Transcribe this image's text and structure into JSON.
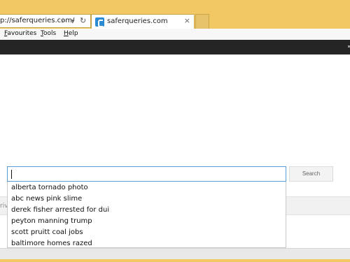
{
  "browser": {
    "address_url": "p://saferqueries.com/",
    "tab_title": "saferqueries.com",
    "tab_close": "×",
    "search_glyph": "⌕",
    "dropdown_glyph": "▾",
    "refresh_glyph": "↻",
    "menu": [
      {
        "label": "Favourites",
        "underline": "F"
      },
      {
        "label": "Tools",
        "underline": "T"
      },
      {
        "label": "Help",
        "underline": "H"
      }
    ],
    "accent_color": "#f2c864"
  },
  "search": {
    "input_value": "",
    "button_label": "Search",
    "suggestions": [
      "alberta tornado photo",
      "abc news pink slime",
      "derek fisher arrested for dui",
      "peyton manning trump",
      "scott pruitt coal jobs",
      "baltimore homes razed"
    ]
  },
  "strip": {
    "partial_text": "rivi"
  },
  "icons": {
    "favicon": "saferqueries-favicon-icon",
    "search": "search-icon",
    "dropdown": "chevron-down-icon",
    "refresh": "refresh-icon",
    "close": "close-icon"
  }
}
